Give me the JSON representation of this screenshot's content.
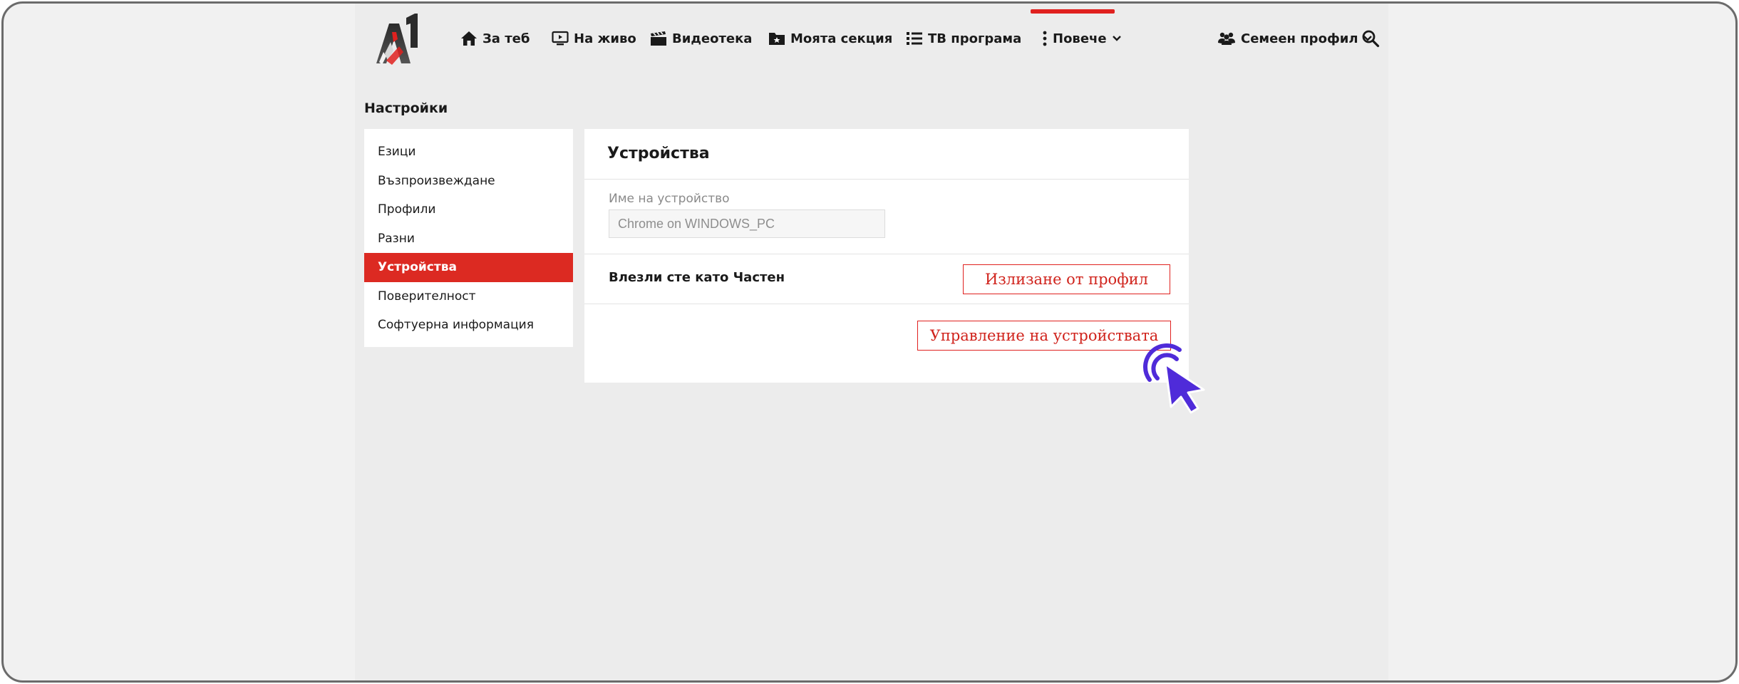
{
  "nav": {
    "items": [
      {
        "label": "За теб",
        "icon": "home-icon"
      },
      {
        "label": "На живо",
        "icon": "tv-icon"
      },
      {
        "label": "Видеотека",
        "icon": "clapperboard-icon"
      },
      {
        "label": "Моята секция",
        "icon": "folder-icon"
      },
      {
        "label": "ТВ програма",
        "icon": "list-icon"
      },
      {
        "label": "Повече",
        "icon": "more-vertical-icon",
        "active": true
      }
    ],
    "profile_label": "Семеен профил",
    "profile_icon": "users-icon",
    "search_icon": "search-icon",
    "accent_color": "#e0211f"
  },
  "settings": {
    "title": "Настройки",
    "menu": [
      {
        "label": "Езици"
      },
      {
        "label": "Възпроизвеждане"
      },
      {
        "label": "Профили"
      },
      {
        "label": "Разни"
      },
      {
        "label": "Устройства",
        "active": true
      },
      {
        "label": "Поверителност"
      },
      {
        "label": "Софтуерна информация"
      }
    ]
  },
  "devices": {
    "title": "Устройства",
    "device_name_label": "Име на устройство",
    "device_name_value": "Chrome on WINDOWS_PC",
    "logged_in_text": "Влезли сте като Частен",
    "logout_button": "Излизане от профил",
    "manage_button": "Управление на устройствата"
  }
}
